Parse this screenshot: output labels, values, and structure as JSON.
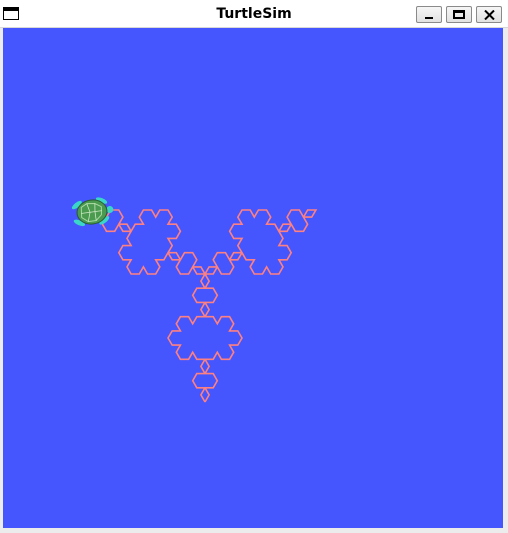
{
  "window": {
    "title": "TurtleSim",
    "buttons": {
      "minimize": "minimize-icon",
      "maximize": "maximize-icon",
      "close": "close-icon"
    }
  },
  "canvas": {
    "background_color": "#4556ff",
    "pen_color": "#ff8080",
    "turtle": {
      "icon": "turtle-icon",
      "shell_color": "#4a9a50",
      "flipper_color": "#3ad6c8"
    }
  }
}
